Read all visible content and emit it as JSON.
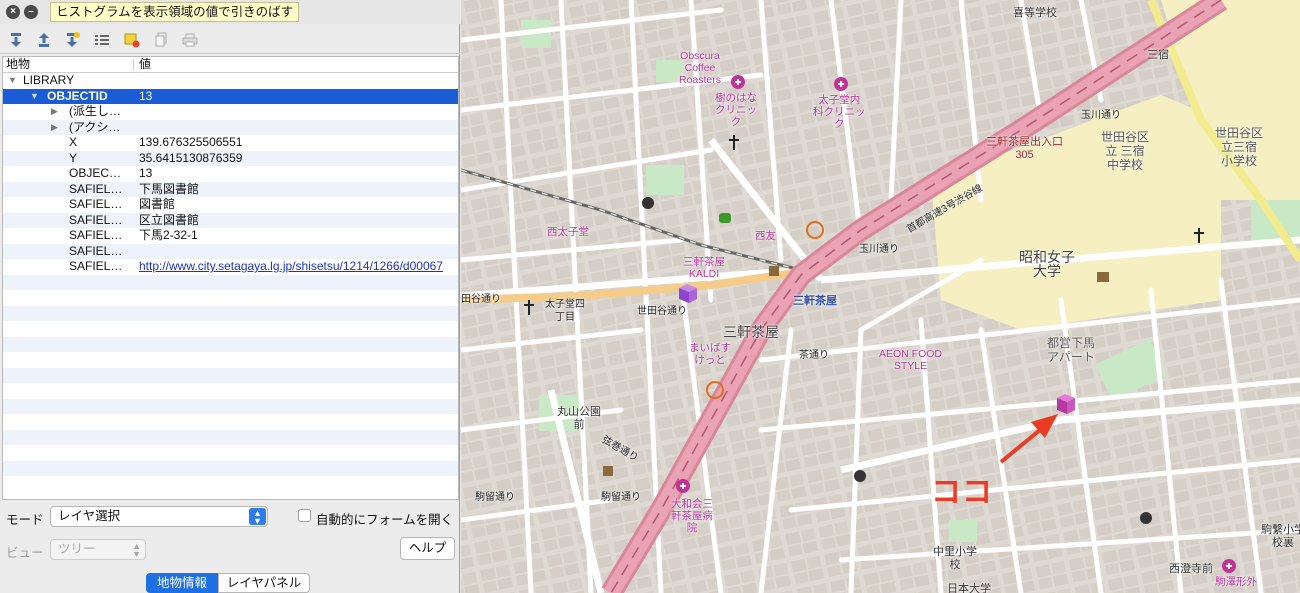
{
  "titlebar": {
    "close_glyph": "×",
    "min_glyph": "–",
    "tooltip": "ヒストグラムを表示領域の値で引きのばす"
  },
  "toolbar": {
    "icons": [
      "expand-all-icon",
      "collapse-all-icon",
      "expand-new-icon",
      "deselect-icon",
      "highlight-icon",
      "copy-icon",
      "print-icon"
    ]
  },
  "tree": {
    "header": {
      "feature": "地物",
      "value": "値"
    },
    "rows": [
      {
        "name": "LIBRARY",
        "value": "",
        "level": 0,
        "arrow": "▼"
      },
      {
        "name": "OBJECTID",
        "value": "13",
        "level": 1,
        "arrow": "▼",
        "selected": true
      },
      {
        "name": "(派生し…",
        "value": "",
        "level": 2,
        "arrow": "▶"
      },
      {
        "name": "(アクシ…",
        "value": "",
        "level": 2,
        "arrow": "▶"
      },
      {
        "name": "X",
        "value": "139.676325506551",
        "level": 2
      },
      {
        "name": "Y",
        "value": "35.6415130876359",
        "level": 2
      },
      {
        "name": "OBJEC…",
        "value": "13",
        "level": 2
      },
      {
        "name": "SAFIEL…",
        "value": "下馬図書館",
        "level": 2
      },
      {
        "name": "SAFIEL…",
        "value": "図書館",
        "level": 2
      },
      {
        "name": "SAFIEL…",
        "value": "区立図書館",
        "level": 2
      },
      {
        "name": "SAFIEL…",
        "value": "下馬2-32-1",
        "level": 2
      },
      {
        "name": "SAFIEL…",
        "value": "",
        "level": 2
      },
      {
        "name": "SAFIEL…",
        "value": "http://www.city.setagaya.lg.jp/shisetsu/1214/1266/d00067",
        "level": 2,
        "link": true
      }
    ]
  },
  "mode": {
    "label": "モード",
    "value": "レイヤ選択",
    "auto_label": "自動的にフォームを開く",
    "auto_checked": false
  },
  "view": {
    "label": "ビュー",
    "value": "ツリー",
    "help_label": "ヘルプ"
  },
  "tabs": {
    "info": "地物情報",
    "layer": "レイヤパネル"
  },
  "map": {
    "labels": {
      "school_top": "喜等学校",
      "obscura": "Obscura\nCoffee\nRoasters",
      "clinic1": "樹のはな\nクリニッ\nク",
      "clinic2": "太子堂内\n科クリニッ\nク",
      "sangenjaya_exit": "三軒茶屋出入口\n305",
      "sangen": "三宿",
      "setagaya_hs": "世田谷区\n立 三宿\n中学校",
      "setagaya_es": "世田谷区\n立三宿\n小学校",
      "tamagawa1": "玉川通り",
      "tamagawa2": "玉川通り",
      "shuto3": "首都高速3号渋谷線",
      "nishitaishido": "西太子堂",
      "nishi": "西友",
      "kaldi": "三軒茶屋\nKALDI",
      "showa": "昭和女子\n大学",
      "setagaya_dori": "世田谷通り",
      "setagaya_dori2": "田谷通り",
      "taishido4": "太子堂四\n丁目",
      "sangenjaya_st": "三軒茶屋",
      "sangenjaya_area": "三軒茶屋",
      "maibasu": "まいばす\nけっと",
      "aeon": "AEON FOOD\nSTYLE",
      "shimouma": "都営下馬\nアパート",
      "marunouchi_park": "丸山公園\n前",
      "chabashi": "茶通り",
      "oyama": "弦巻通り",
      "kemazawa": "駒留通り",
      "kouzu": "駒留通り",
      "hospital": "大和会三\n軒茶屋病\n院",
      "chuumei": "中里小学\n校",
      "nihon_univ": "日本大学",
      "komazawa": "駒繋小学\n校裏",
      "nishizumi": "西澄寺前",
      "kaiyo": "駒澤形外",
      "koko": "ココ"
    }
  }
}
